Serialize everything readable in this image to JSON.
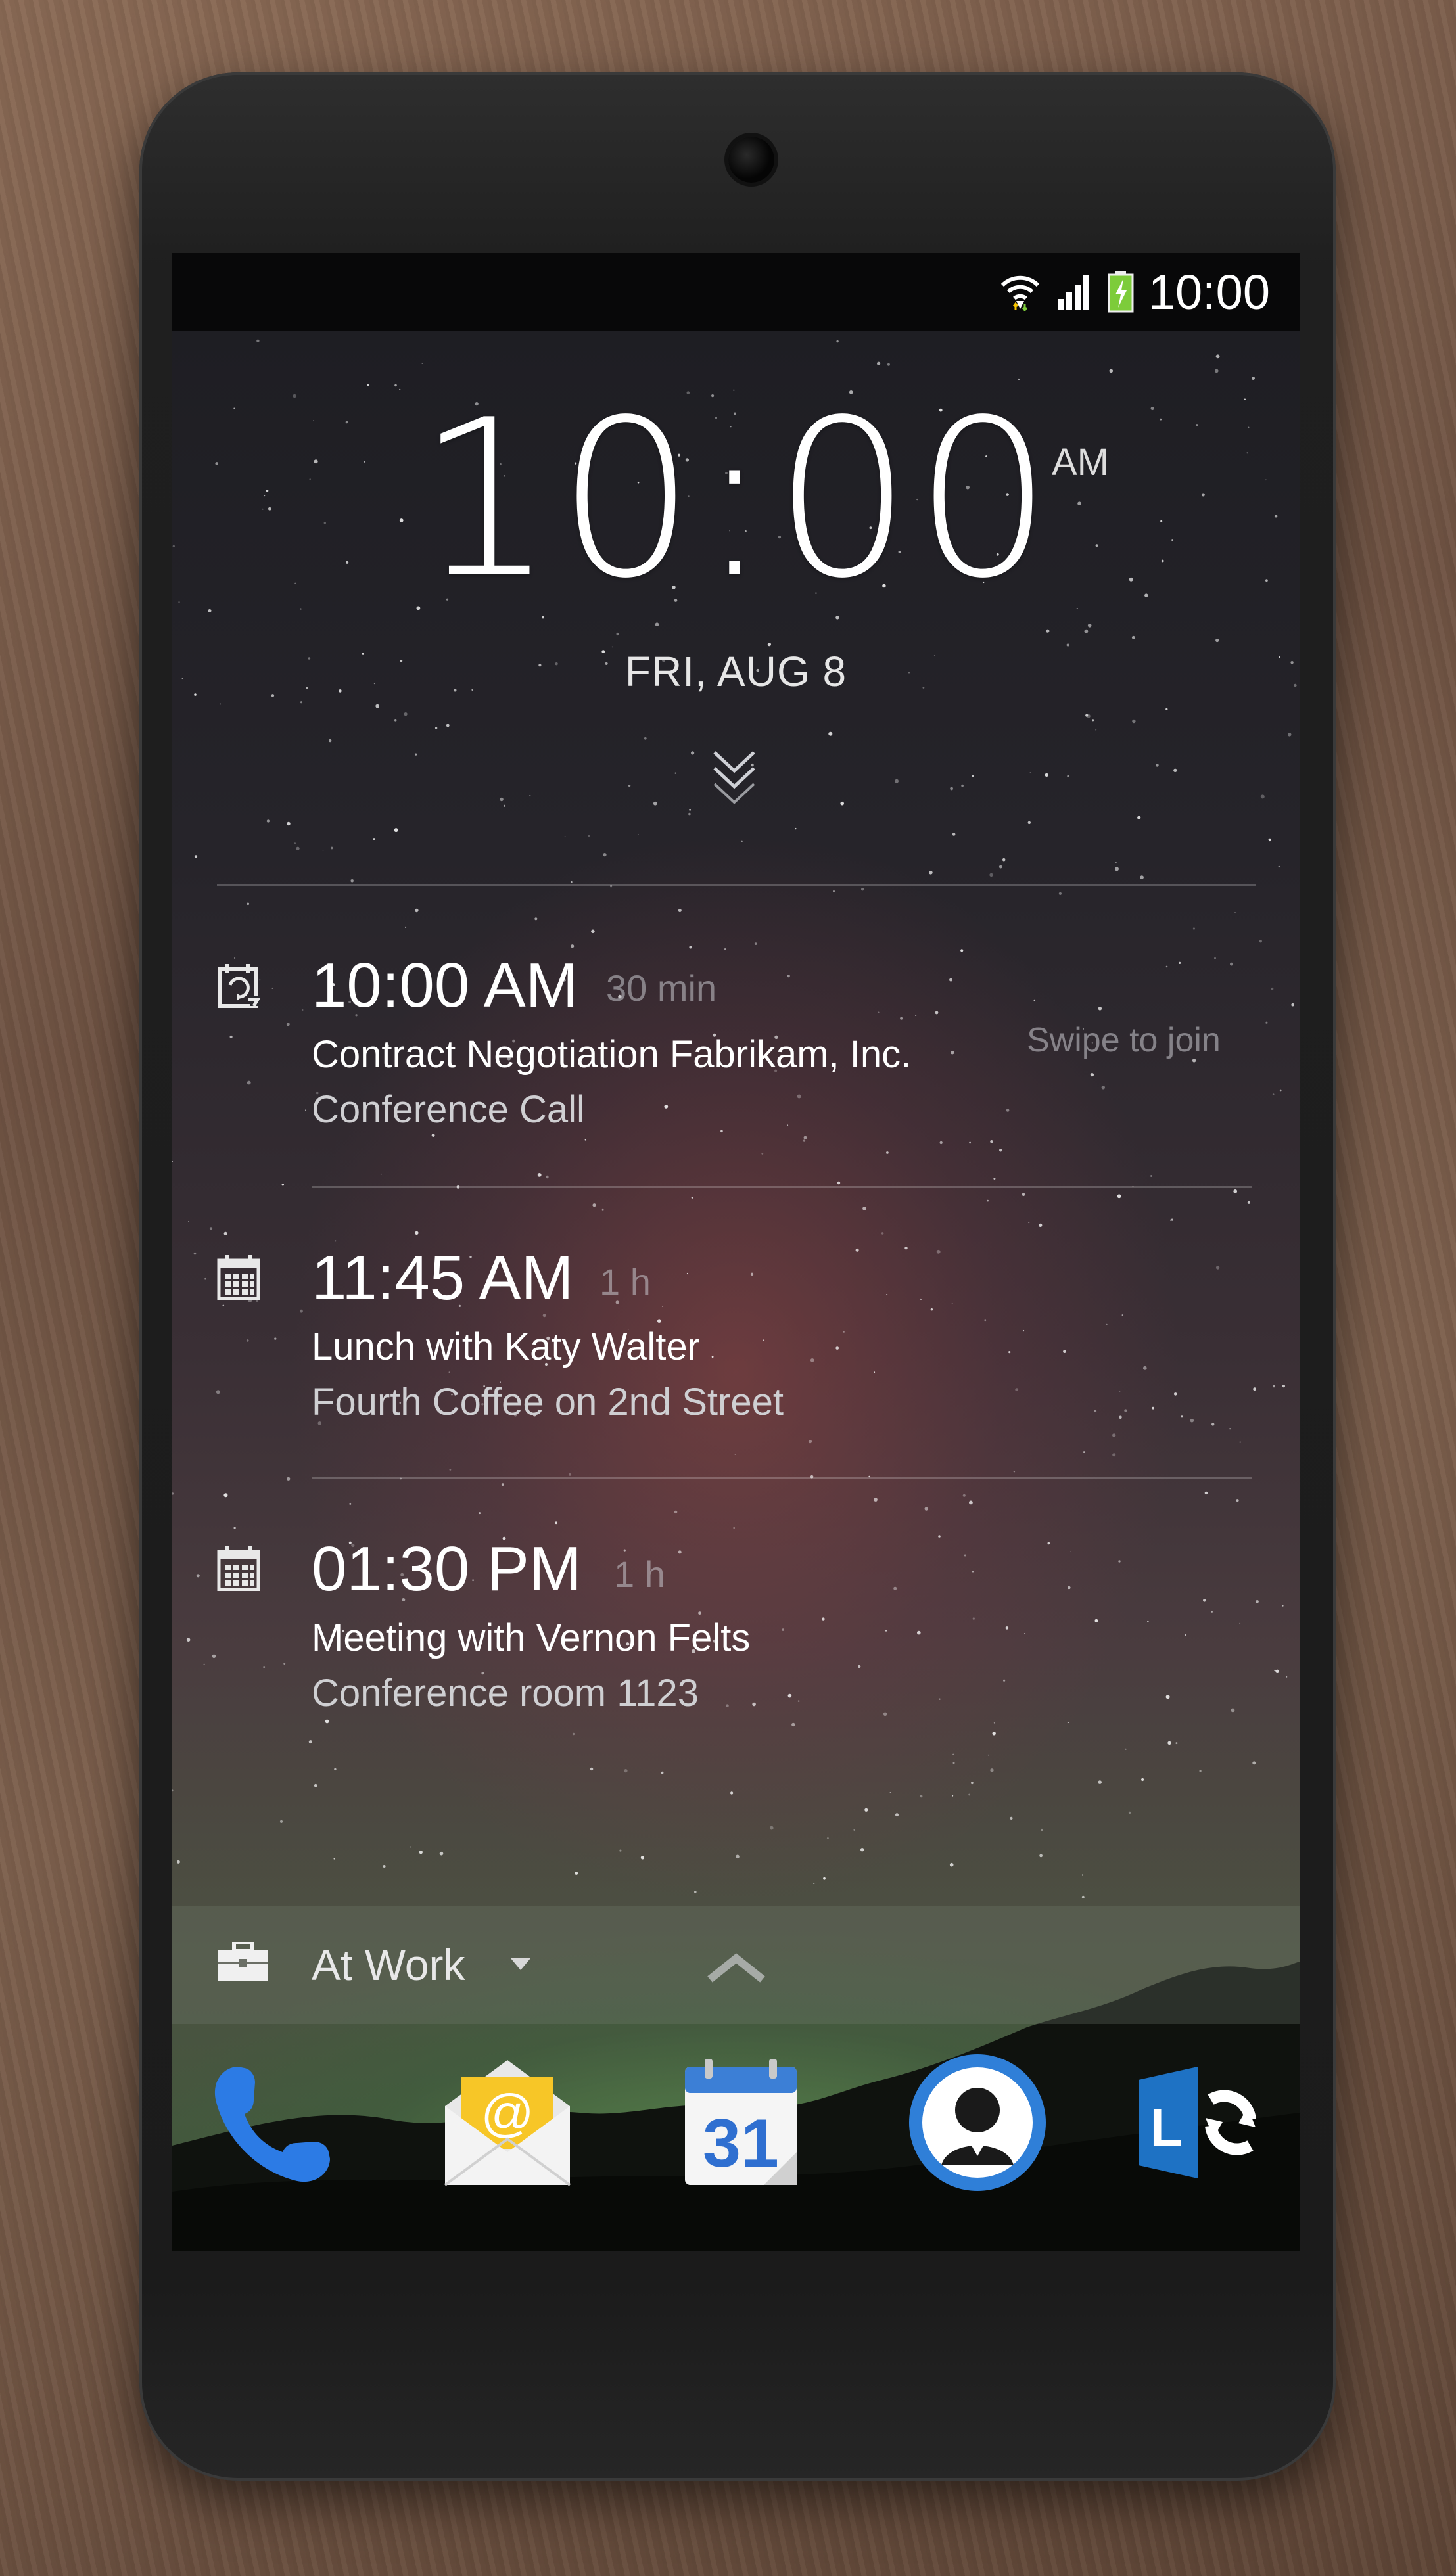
{
  "status_bar": {
    "time": "10:00",
    "icons": [
      "wifi-icon",
      "signal-icon",
      "battery-charging-icon"
    ]
  },
  "lockscreen": {
    "clock": "10:00",
    "ampm": "AM",
    "date": "FRI, AUG 8"
  },
  "events": [
    {
      "icon": "calendar-sync-icon",
      "time": "10:00 AM",
      "duration": "30 min",
      "title": "Contract Negotiation Fabrikam, Inc.",
      "location": "Conference Call",
      "action": "Swipe to join"
    },
    {
      "icon": "calendar-icon",
      "time": "11:45 AM",
      "duration": "1 h",
      "title": "Lunch with Katy Walter",
      "location": "Fourth Coffee on 2nd Street"
    },
    {
      "icon": "calendar-icon",
      "time": "01:30 PM",
      "duration": "1 h",
      "title": "Meeting with Vernon Felts",
      "location": "Conference room 1123"
    }
  ],
  "profile": {
    "icon": "briefcase-icon",
    "label": "At Work"
  },
  "dock": {
    "apps": [
      "phone-icon",
      "email-icon",
      "calendar-app-icon",
      "contacts-icon",
      "lync-icon"
    ],
    "calendar_day": "31",
    "lync_letter": "L",
    "email_symbol": "@"
  },
  "colors": {
    "phone_blue": "#2c7be5",
    "contacts_blue": "#2f7fd8",
    "lync_blue": "#1e72c4",
    "battery_green": "#7dcc3a"
  }
}
